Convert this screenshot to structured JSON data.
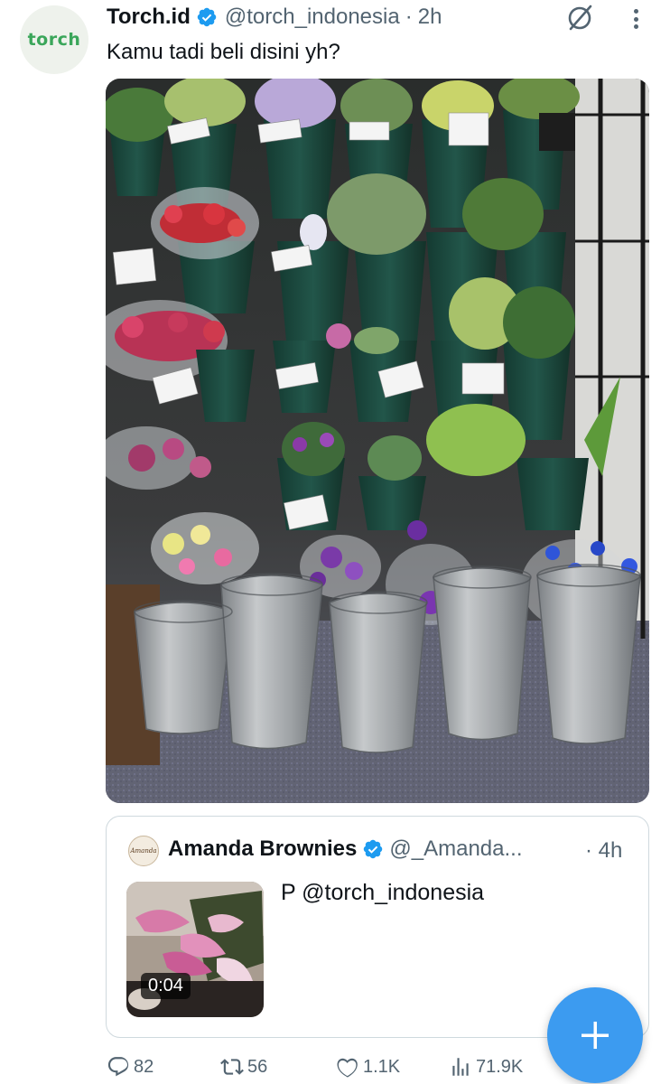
{
  "tweet": {
    "avatar_text": "torch",
    "display_name": "Torch.id",
    "handle": "@torch_indonesia",
    "separator": "·",
    "time": "2h",
    "text": "Kamu tadi beli disini yh?",
    "photo_icon": "flower-shop-photo"
  },
  "quote": {
    "avatar_text": "Amanda",
    "display_name": "Amanda Brownies",
    "handle": "@_Amanda...",
    "separator": "·",
    "time": "4h",
    "text": "P @torch_indonesia",
    "video_duration": "0:04"
  },
  "actions": {
    "replies": "82",
    "reposts": "56",
    "likes": "1.1K",
    "views": "71.9K"
  },
  "icons": {
    "verified": "verified-badge-icon",
    "grok": "grok-icon",
    "more": "more-icon",
    "reply": "reply-icon",
    "repost": "repost-icon",
    "like": "heart-icon",
    "views": "views-icon",
    "compose": "plus-icon"
  },
  "colors": {
    "verified": "#1d9bf0",
    "fab": "#3c9bf0",
    "secondary_text": "#536471",
    "avatar_brand": "#3aa65a"
  }
}
